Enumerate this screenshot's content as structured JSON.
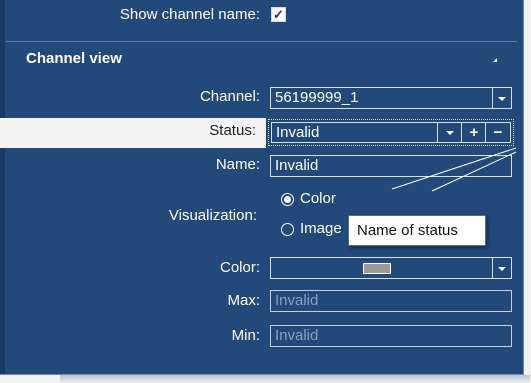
{
  "show_channel_name": {
    "label": "Show channel name:",
    "checked": true,
    "check_glyph": "✓"
  },
  "section": {
    "title": "Channel view",
    "collapse_icon": "collapse-triangle-icon"
  },
  "channel": {
    "label": "Channel:",
    "value": "56199999_1"
  },
  "status": {
    "label": "Status:",
    "value": "Invalid",
    "add_glyph": "+",
    "remove_glyph": "−"
  },
  "name": {
    "label": "Name:",
    "value": "Invalid"
  },
  "visualization": {
    "label": "Visualization:",
    "options": [
      {
        "label": "Color",
        "selected": true
      },
      {
        "label": "Image",
        "selected": false
      }
    ]
  },
  "tooltip": {
    "text": "Name of status"
  },
  "color": {
    "label": "Color:",
    "swatch": "#9a9a9a"
  },
  "max": {
    "label": "Max:",
    "value": "Invalid"
  },
  "min": {
    "label": "Min:",
    "value": "Invalid"
  },
  "theme": {
    "panel": "#23497a",
    "text": "#ffffff",
    "highlight_row": "#f4f4f4"
  }
}
